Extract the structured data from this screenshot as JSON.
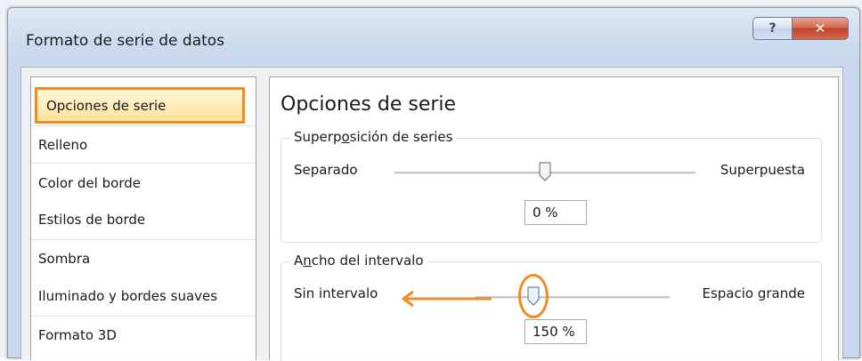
{
  "window": {
    "title": "Formato de serie de datos",
    "help_label": "?",
    "close_label": "✕"
  },
  "nav": {
    "items": [
      {
        "label": "Opciones de serie",
        "selected": true
      },
      {
        "label": "Relleno"
      },
      {
        "label": "Color del borde"
      },
      {
        "label": "Estilos de borde"
      },
      {
        "label": "Sombra"
      },
      {
        "label": "Iluminado y bordes suaves"
      },
      {
        "label": "Formato 3D"
      }
    ]
  },
  "panel": {
    "heading": "Opciones de serie",
    "overlap": {
      "label_pre": "Superp",
      "label_access": "o",
      "label_post": "sición de series",
      "left_label": "Separado",
      "right_label": "Superpuesta",
      "value_text": "0 %",
      "slider_fraction": 0.5
    },
    "gap": {
      "label_pre": "A",
      "label_access": "n",
      "label_post": "cho del intervalo",
      "left_label": "Sin intervalo",
      "right_label": "Espacio grande",
      "value_text": "150 %",
      "slider_fraction": 0.3
    }
  },
  "colors": {
    "highlight": "#f28a24",
    "selected_bg": "#ffe29a",
    "close_red": "#c2412a"
  }
}
